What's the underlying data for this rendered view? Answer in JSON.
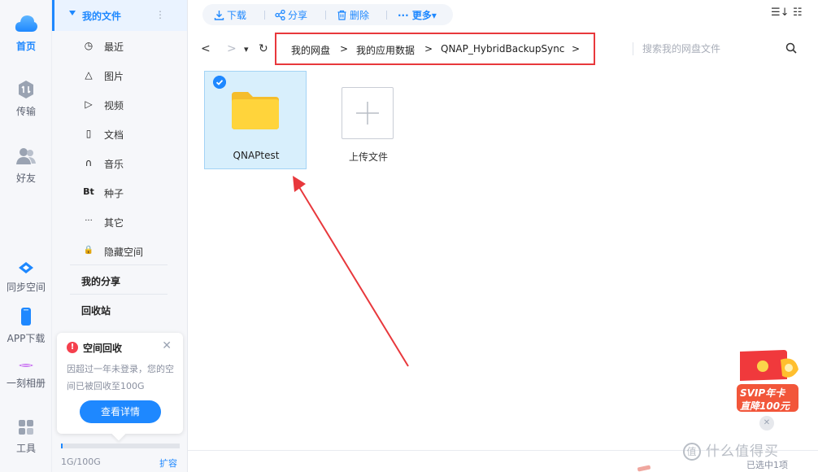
{
  "rail": {
    "items": [
      {
        "label": "首页",
        "icon": "cloud-icon"
      },
      {
        "label": "传输",
        "icon": "transfer-icon"
      },
      {
        "label": "好友",
        "icon": "friends-icon"
      },
      {
        "label": "同步空间",
        "icon": "sync-space-icon"
      },
      {
        "label": "APP下载",
        "icon": "phone-icon"
      },
      {
        "label": "一刻相册",
        "icon": "album-icon"
      },
      {
        "label": "工具",
        "icon": "tools-icon"
      }
    ]
  },
  "sidebar": {
    "my_files": "我的文件",
    "more": "⋮",
    "sub_items": [
      {
        "label": "最近",
        "icon": "clock-icon",
        "glyph": "◷"
      },
      {
        "label": "图片",
        "icon": "image-icon",
        "glyph": "△"
      },
      {
        "label": "视频",
        "icon": "video-icon",
        "glyph": "▷"
      },
      {
        "label": "文档",
        "icon": "document-icon",
        "glyph": "▯"
      },
      {
        "label": "音乐",
        "icon": "headphones-icon",
        "glyph": "∩"
      },
      {
        "label": "种子",
        "icon": "bt-icon",
        "glyph": "Bt"
      },
      {
        "label": "其它",
        "icon": "ellipsis-icon",
        "glyph": "···"
      },
      {
        "label": "隐藏空间",
        "icon": "lock-icon",
        "glyph": "🔒"
      }
    ],
    "my_share": "我的分享",
    "recycle_bin": "回收站"
  },
  "reclaim_card": {
    "warn_glyph": "!",
    "title": "空间回收",
    "close_glyph": "✕",
    "description": "因超过一年未登录，您的空间已被回收至100G",
    "button": "查看详情"
  },
  "quota": {
    "text": "1G/100G",
    "used_fraction": 0.01,
    "expand": "扩容"
  },
  "toolbar": {
    "download": "下载",
    "share": "分享",
    "delete": "删除",
    "more": "··· 更多▾"
  },
  "nav": {
    "back": "<",
    "forward": ">",
    "dropdown": "▾",
    "refresh": "↻"
  },
  "breadcrumb": {
    "items": [
      "我的网盘",
      "我的应用数据",
      "QNAP_HybridBackupSync"
    ],
    "separator": ">"
  },
  "search": {
    "placeholder": "搜索我的网盘文件"
  },
  "files": [
    {
      "name": "QNAPtest",
      "type": "folder",
      "selected": true
    }
  ],
  "upload": {
    "label": "上传文件"
  },
  "promo": {
    "line1": "SVIP年卡",
    "line2": "直降100元"
  },
  "status": {
    "text": "已选中1项"
  },
  "watermark": {
    "icon_glyph": "值",
    "text": "什么值得买"
  },
  "colors": {
    "accent": "#1e88ff",
    "annotation": "#e8383c",
    "folder": "#ffd43b",
    "selected_tile": "#d8effc"
  }
}
